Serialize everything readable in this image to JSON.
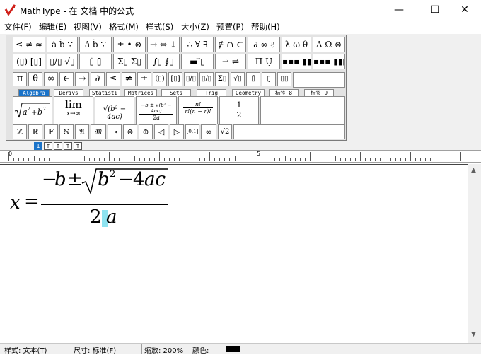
{
  "window": {
    "title": "MathType - 在 文档 中的公式",
    "min": "—",
    "max": "☐",
    "close": "✕",
    "logo_icon": "mathtype-logo"
  },
  "menu": [
    "文件(F)",
    "编辑(E)",
    "视图(V)",
    "格式(M)",
    "样式(S)",
    "大小(Z)",
    "预置(P)",
    "帮助(H)"
  ],
  "palette": {
    "row1": [
      "≤ ≠ ≈",
      "ȧ ḃ ∵",
      "± • ⊗",
      "→ ⇔ ↓",
      "∴ ∀ ∃",
      "∉ ∩ ⊂",
      "∂ ∞ ℓ",
      "λ ω θ",
      "Λ Ω ⊗"
    ],
    "row2": [
      "(▯) [▯]",
      "▯/▯ √▯",
      "▯̈ ▯̄",
      "Σ▯ Σ▯",
      "∫▯ ∮▯",
      "▬ ⃗▯",
      "⇀ ⇌",
      "Π̅ Ụ",
      "▪▪▪ ▮▮▮"
    ],
    "row3": [
      "π",
      "θ",
      "∞",
      "∈",
      "→",
      "∂",
      "≤",
      "≠",
      "±",
      "(▯)",
      "[▯]",
      "▯/▯",
      "▯/▯",
      "Σ▯",
      "√▯",
      "▯̄",
      "▯̣",
      "▯▯"
    ],
    "tabs": [
      "Algebra",
      "Derivs",
      "Statisti",
      "Matrices",
      "Sets",
      "Trig",
      "Geometry",
      "标签 8",
      "标签 9"
    ],
    "templates": [
      "√(a² + b²)",
      "lim",
      "x→∞",
      "√(b² − 4ac)",
      "−b ± √(b² − 4ac)",
      "2a",
      "n!",
      "r!(n − r)!",
      "1",
      "2"
    ],
    "row4": [
      "ℤ",
      "ℝ",
      "𝔽",
      "𝕊",
      "𝔄",
      "𝔐",
      "⊸",
      "⊗",
      "⊕",
      "◁",
      "▷",
      "[0,1]",
      "∞",
      "√2"
    ],
    "tinybtns": [
      "1",
      "↑",
      "↑",
      "↑",
      "↑"
    ]
  },
  "ruler": {
    "labels": [
      "0",
      "5"
    ]
  },
  "equation": {
    "lhs": "x",
    "eq": "=",
    "num_minus": "−",
    "num_b": "b",
    "pm": "±",
    "rad_b": "b",
    "sq": "2",
    "minus2": "−",
    "four_ac": "4",
    "ac": "ac",
    "den_2": "2",
    "den_a": "a"
  },
  "status": {
    "style": "样式: 文本(T)",
    "size": "尺寸: 标准(F)",
    "zoom": "缩放: 200%",
    "color_label": "颜色:",
    "color_value": "#000000"
  }
}
